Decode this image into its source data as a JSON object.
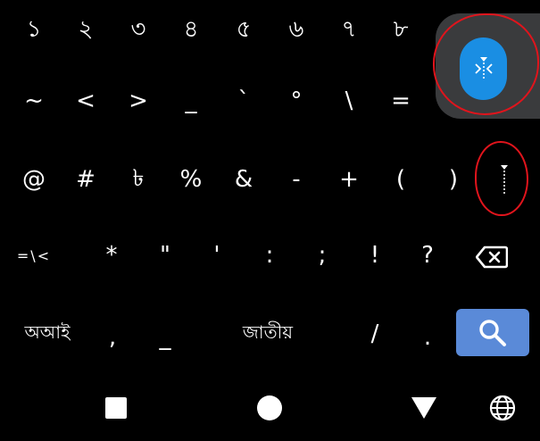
{
  "keyboard": {
    "row1": [
      "১",
      "২",
      "৩",
      "৪",
      "৫",
      "৬",
      "৭",
      "৮"
    ],
    "row2": [
      "~",
      "<",
      ">",
      "_",
      "`",
      "°",
      "\\",
      "="
    ],
    "row3": [
      "@",
      "#",
      "৳",
      "%",
      "&",
      "-",
      "+",
      "(",
      ")"
    ],
    "row4": [
      "=\\<",
      "*",
      "\"",
      "'",
      ":",
      ";",
      "!",
      "?"
    ],
    "row5": {
      "lang_label": "অআই",
      "comma": ",",
      "underscore": "_",
      "space_label": "জাতীয়",
      "slash": "/",
      "period": "."
    }
  },
  "icons": {
    "backspace": "backspace-icon",
    "search": "search-icon",
    "split_toggle": "collapse-arrows-icon",
    "cursor_handle": "cursor-marker-icon",
    "nav_recents": "square-icon",
    "nav_home": "circle-icon",
    "nav_back": "triangle-down-icon",
    "language": "globe-icon"
  },
  "colors": {
    "background": "#000000",
    "key_text": "#ffffff",
    "accent_blue": "#1a8ee3",
    "search_button": "#5a8ad8",
    "overlay_gray": "#3a3b3d",
    "annotation_red": "#e0141c"
  }
}
